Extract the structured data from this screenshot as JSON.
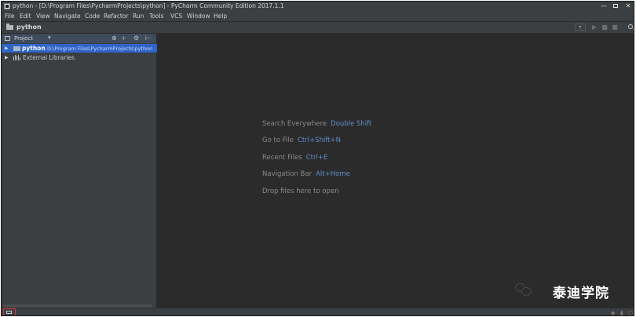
{
  "window": {
    "title": "python - [D:\\Program Files\\PycharmProjects\\python] - PyCharm Community Edition 2017.1.1",
    "controls": {
      "minimize": "—",
      "close": "✕"
    }
  },
  "menu": [
    "File",
    "Edit",
    "View",
    "Navigate",
    "Code",
    "Refactor",
    "Run",
    "Tools",
    "VCS",
    "Window",
    "Help"
  ],
  "navbar": {
    "title": "python",
    "run_dropdown": "▾"
  },
  "project_panel": {
    "header_label": "Project",
    "dropdown": "▾",
    "tools": [
      "⊕",
      "÷",
      "⚙",
      "⊢"
    ],
    "tree": [
      {
        "name": "python",
        "path": "D:\\Program Files\\PycharmProjects\\python",
        "expand": "▶"
      },
      {
        "name": "External Libraries",
        "expand": "▶"
      }
    ]
  },
  "editor": {
    "hints": [
      {
        "label": "Search Everywhere",
        "key": "Double Shift"
      },
      {
        "label": "Go to File",
        "key": "Ctrl+Shift+N"
      },
      {
        "label": "Recent Files",
        "key": "Ctrl+E"
      },
      {
        "label": "Navigation Bar",
        "key": "Alt+Home"
      },
      {
        "label": "Drop files here to open",
        "key": ""
      }
    ]
  },
  "watermark": {
    "text": "泰迪学院"
  }
}
